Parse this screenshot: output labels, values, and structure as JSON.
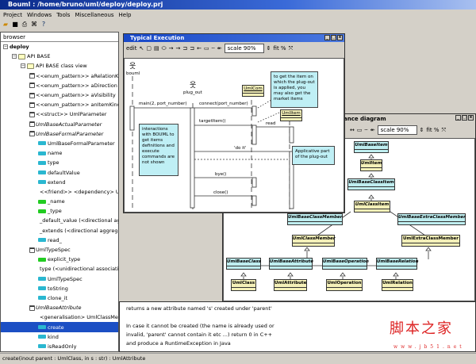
{
  "window": {
    "title": "Bouml : /home/bruno/uml/deploy/deploy.prj"
  },
  "menu": [
    "Project",
    "Windows",
    "Tools",
    "Miscellaneous",
    "Help"
  ],
  "toolbar_icons": [
    "open-icon",
    "save-icon",
    "print-icon",
    "find-icon",
    "help-icon"
  ],
  "browser": {
    "header": "browser",
    "items": [
      {
        "label": "deploy",
        "level": 0,
        "icon": "none",
        "exp": "-",
        "bold": true
      },
      {
        "label": "API BASE",
        "level": 1,
        "icon": "pkg",
        "exp": "-"
      },
      {
        "label": "API BASE class view",
        "level": 2,
        "icon": "pkg",
        "exp": "-"
      },
      {
        "label": "<<enum_pattern>> aRelationKind",
        "level": 3,
        "icon": "cls",
        "exp": "+"
      },
      {
        "label": "<<enum_pattern>> aDirection",
        "level": 3,
        "icon": "cls",
        "exp": "+"
      },
      {
        "label": "<<enum_pattern>> aVisibility",
        "level": 3,
        "icon": "cls",
        "exp": "+"
      },
      {
        "label": "<<enum_pattern>> anItemKind",
        "level": 3,
        "icon": "cls",
        "exp": "+"
      },
      {
        "label": "<<struct>> UmlParameter",
        "level": 3,
        "icon": "cls",
        "exp": "+"
      },
      {
        "label": "UmlBaseActualParameter",
        "level": 3,
        "icon": "cls",
        "exp": "+",
        "italic": true
      },
      {
        "label": "UmlBaseFormalParameter",
        "level": 3,
        "icon": "cls",
        "exp": "-",
        "italic": true
      },
      {
        "label": "UmlBaseFormalParameter",
        "level": 4,
        "icon": "op"
      },
      {
        "label": "name",
        "level": 4,
        "icon": "op"
      },
      {
        "label": "type",
        "level": 4,
        "icon": "op"
      },
      {
        "label": "defaultValue",
        "level": 4,
        "icon": "op"
      },
      {
        "label": "extend",
        "level": 4,
        "icon": "op"
      },
      {
        "label": "<<friend>> <dependency> UmlBaseFormalParameter",
        "level": 4,
        "icon": "rel"
      },
      {
        "label": "_name",
        "level": 4,
        "icon": "attr"
      },
      {
        "label": "_type",
        "level": 4,
        "icon": "attr"
      },
      {
        "label": "_default_value (<directional aggregation>)",
        "level": 4,
        "icon": "rel"
      },
      {
        "label": "_extends (<directional aggregation>)",
        "level": 4,
        "icon": "rel"
      },
      {
        "label": "read_",
        "level": 4,
        "icon": "op"
      },
      {
        "label": "UmlTypeSpec",
        "level": 3,
        "icon": "cls",
        "exp": "-"
      },
      {
        "label": "explicit_type",
        "level": 4,
        "icon": "attr"
      },
      {
        "label": "type (<unidirectional association>)",
        "level": 4,
        "icon": "rel"
      },
      {
        "label": "UmlTypeSpec",
        "level": 4,
        "icon": "op"
      },
      {
        "label": "toString",
        "level": 4,
        "icon": "op"
      },
      {
        "label": "clone_it",
        "level": 4,
        "icon": "op"
      },
      {
        "label": "UmlBaseAttribute",
        "level": 3,
        "icon": "cls",
        "exp": "-",
        "italic": true
      },
      {
        "label": "<generalisation> UmlClassMember",
        "level": 4,
        "icon": "rel"
      },
      {
        "label": "create",
        "level": 4,
        "icon": "op",
        "selected": true
      },
      {
        "label": "kind",
        "level": 4,
        "icon": "op"
      },
      {
        "label": "isReadOnly",
        "level": 4,
        "icon": "op"
      }
    ]
  },
  "status": "create(inout parent : UmlClass, in s : str) : UmlAttribute",
  "seq": {
    "title": "Typical Execution",
    "edit": "edit",
    "scale": "scale 90%",
    "fit": "fit %",
    "actors": [
      "bouml",
      "plug_out"
    ],
    "objects": [
      "UmlCom",
      "UmlItem"
    ],
    "messages": [
      "main(2, port_number)",
      "connect(port_number)",
      "targetItem()",
      "read",
      "'do it'",
      "bye()",
      "close()"
    ],
    "notes": [
      "to get the item on which the plug-out is applied, you may also get the market items",
      "interactions with BOUML to get items definitions and execute commands are not shown",
      "Applicative part of the plug-out"
    ]
  },
  "inh": {
    "title": "ance diagram",
    "scale": "scale 90%",
    "fit": "fit %",
    "classes": {
      "UmlBaseItem": "UmlBaseItem",
      "UmlItem": "UmlItem",
      "UmlBaseClassItem": "UmlBaseClassItem",
      "UmlClassItem": "UmlClassItem",
      "UmlBaseClassMember": "UmlBaseClassMember",
      "UmlBaseExtraClassMember": "UmlBaseExtraClassMember",
      "UmlClassMember": "UmlClassMember",
      "UmlExtraClassMember": "UmlExtraClassMember",
      "UmlBaseClass": "UmlBaseClass",
      "UmlBaseAttribute": "UmlBaseAttribute",
      "UmlBaseOperation": "UmlBaseOperation",
      "UmlBaseRelation": "UmlBaseRelation",
      "UmlClass": "UmlClass",
      "UmlAttribute": "UmlAttribute",
      "UmlOperation": "UmlOperation",
      "UmlRelation": "UmlRelation"
    }
  },
  "description": [
    "returns a new attribute named 's' created under 'parent'",
    "",
    "In case it cannot be created (the name is already used or",
    "invalid, 'parent' cannot contain it etc ...) return 0 in C++",
    "and produce a RuntimeException in Java"
  ],
  "watermark": {
    "cn": "脚本之家",
    "url": "www.jb51.net"
  },
  "colors": {
    "title": "#1848c8",
    "note": "#bfeff5",
    "base_class": "#bfeef0",
    "user_class": "#f4f0b8",
    "selection": "#1c4fc4"
  }
}
